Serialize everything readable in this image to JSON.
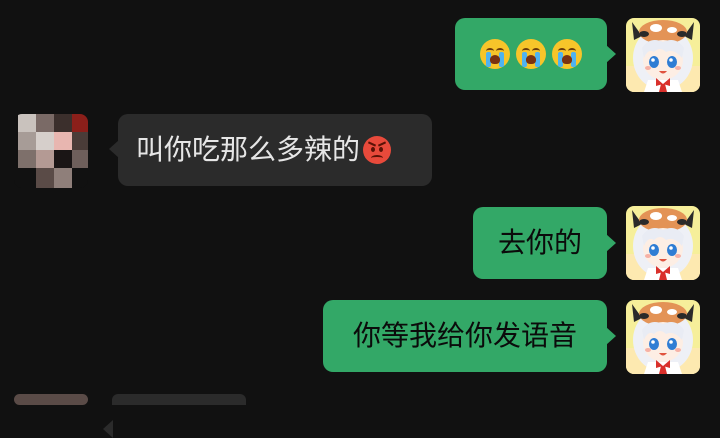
{
  "messages": [
    {
      "id": "m1",
      "direction": "outgoing",
      "text": "",
      "emojis": [
        "loudly-crying-face",
        "loudly-crying-face",
        "loudly-crying-face"
      ]
    },
    {
      "id": "m2",
      "direction": "incoming",
      "text": "叫你吃那么多辣的",
      "trailing_emoji": "angry-face"
    },
    {
      "id": "m3",
      "direction": "outgoing",
      "text": "去你的"
    },
    {
      "id": "m4",
      "direction": "outgoing",
      "text": "你等我给你发语音"
    }
  ],
  "colors": {
    "background": "#111111",
    "outgoing_bubble": "#33a867",
    "incoming_bubble": "#2b2b2b",
    "outgoing_text": "#0b0b0b",
    "incoming_text": "#e6e6e6"
  },
  "avatars": {
    "self": "anime-girl-cow-horns-avatar",
    "contact": "pixelated-avatar"
  }
}
